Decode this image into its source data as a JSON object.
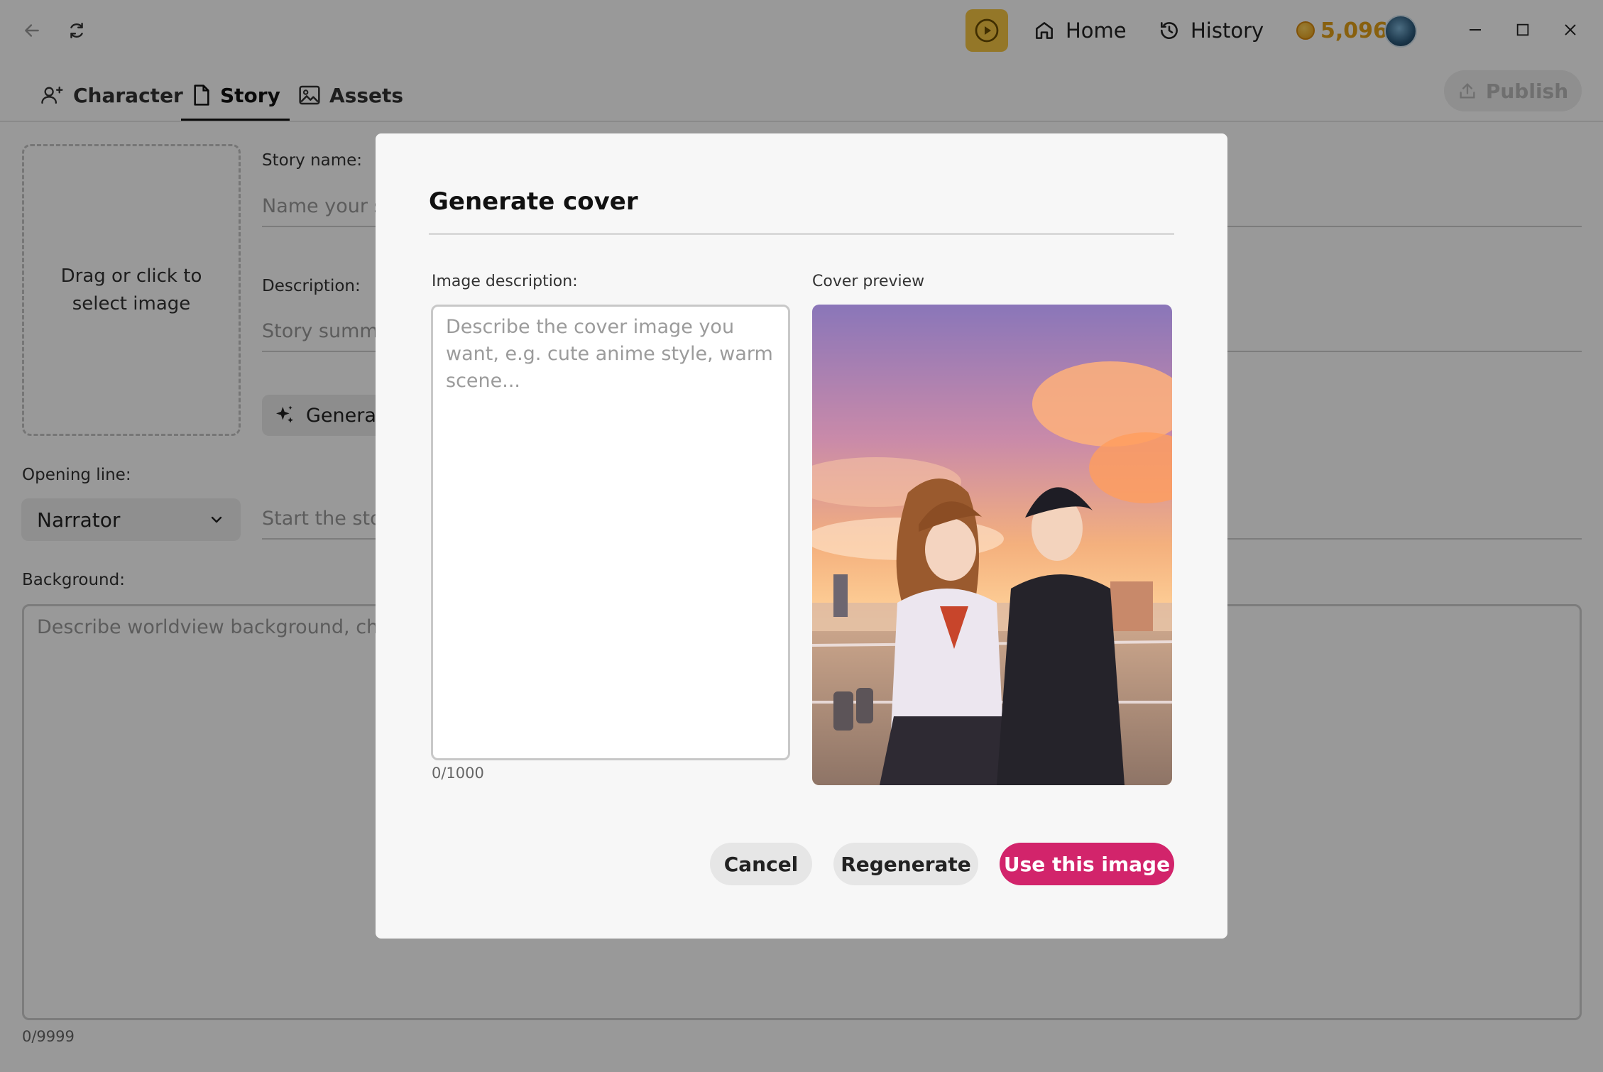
{
  "titlebar": {
    "home_label": "Home",
    "history_label": "History",
    "coins": "5,096"
  },
  "tabs": [
    {
      "label": "Character",
      "icon": "add-person-icon"
    },
    {
      "label": "Story",
      "icon": "document-icon"
    },
    {
      "label": "Assets",
      "icon": "image-icon"
    }
  ],
  "publish_label": "Publish",
  "form": {
    "cover_dropzone_text": "Drag or click to select image",
    "story_name_label": "Story name:",
    "story_name_placeholder": "Name your st",
    "description_label": "Description:",
    "description_placeholder": "Story summa",
    "generate_label": "Generat",
    "opening_line_label": "Opening line:",
    "opening_speaker": "Narrator",
    "opening_placeholder": "Start the stor",
    "background_label": "Background:",
    "background_placeholder": "Describe worldview background, chara",
    "background_count": "0/9999"
  },
  "modal": {
    "title": "Generate cover",
    "image_description_label": "Image description:",
    "image_description_placeholder": "Describe the cover image you want, e.g. cute anime style, warm scene...",
    "char_count": "0/1000",
    "cover_preview_label": "Cover preview",
    "cancel_label": "Cancel",
    "regenerate_label": "Regenerate",
    "use_label": "Use this image"
  },
  "colors": {
    "accent": "#d2246b",
    "coin": "#e3a018",
    "play": "#f7c744"
  }
}
